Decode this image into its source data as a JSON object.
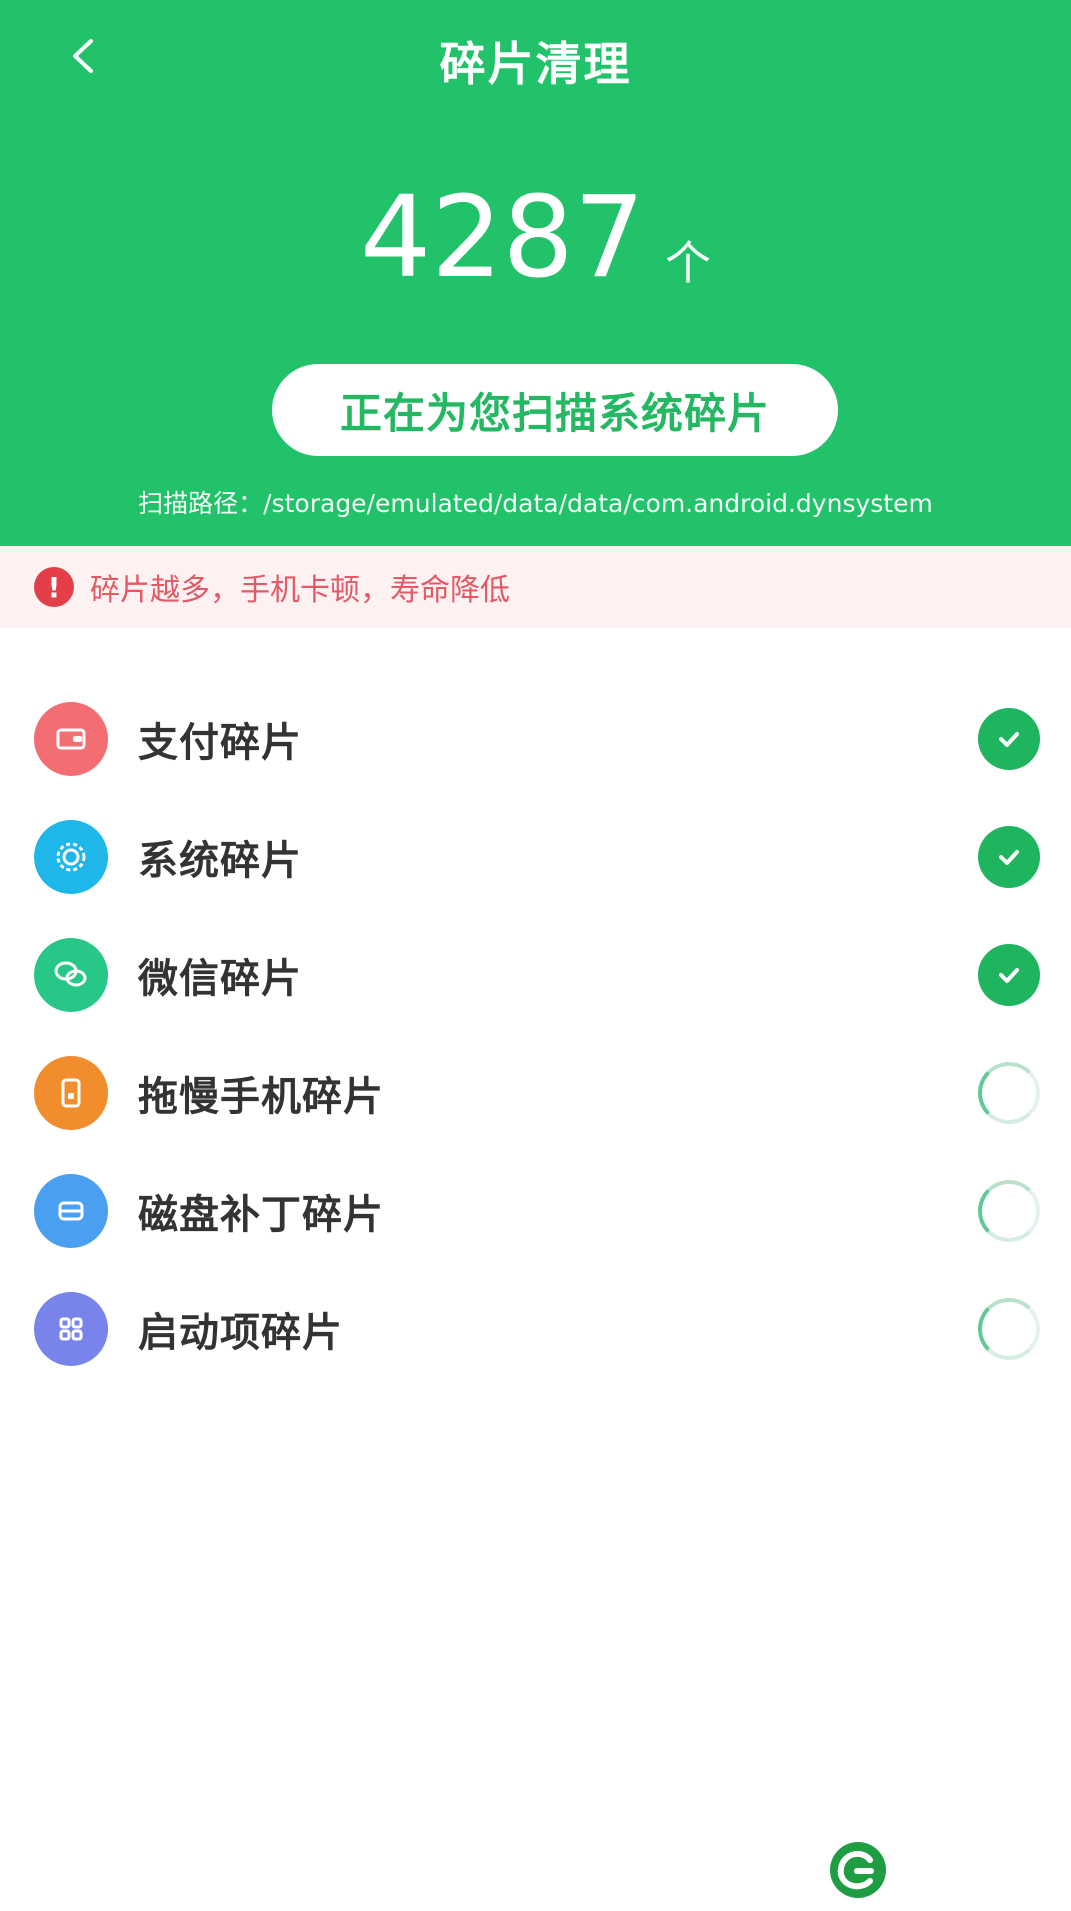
{
  "header": {
    "title": "碎片清理",
    "count": "4287",
    "count_suffix": "个",
    "scan_status": "正在为您扫描系统碎片",
    "scan_path": "扫描路径：/storage/emulated/data/data/com.android.dynsystem"
  },
  "warning": {
    "text": "碎片越多，手机卡顿，寿命降低",
    "icon": "alert-circle-icon",
    "color": "#e15a66"
  },
  "items": [
    {
      "label": "支付碎片",
      "icon": "wallet-icon",
      "color": "#f26e72",
      "status": "done"
    },
    {
      "label": "系统碎片",
      "icon": "gear-icon",
      "color": "#1fb6ea",
      "status": "done"
    },
    {
      "label": "微信碎片",
      "icon": "wechat-icon",
      "color": "#27c887",
      "status": "done"
    },
    {
      "label": "拖慢手机碎片",
      "icon": "phone-icon",
      "color": "#f28d2d",
      "status": "loading"
    },
    {
      "label": "磁盘补丁碎片",
      "icon": "disk-icon",
      "color": "#4a9ff0",
      "status": "loading"
    },
    {
      "label": "启动项碎片",
      "icon": "apps-grid-icon",
      "color": "#7884ea",
      "status": "loading"
    }
  ],
  "colors": {
    "primary": "#21c26a",
    "success": "#1fb55f",
    "warning_bg": "#fdf1f2",
    "warning_icon": "#e43f49"
  }
}
